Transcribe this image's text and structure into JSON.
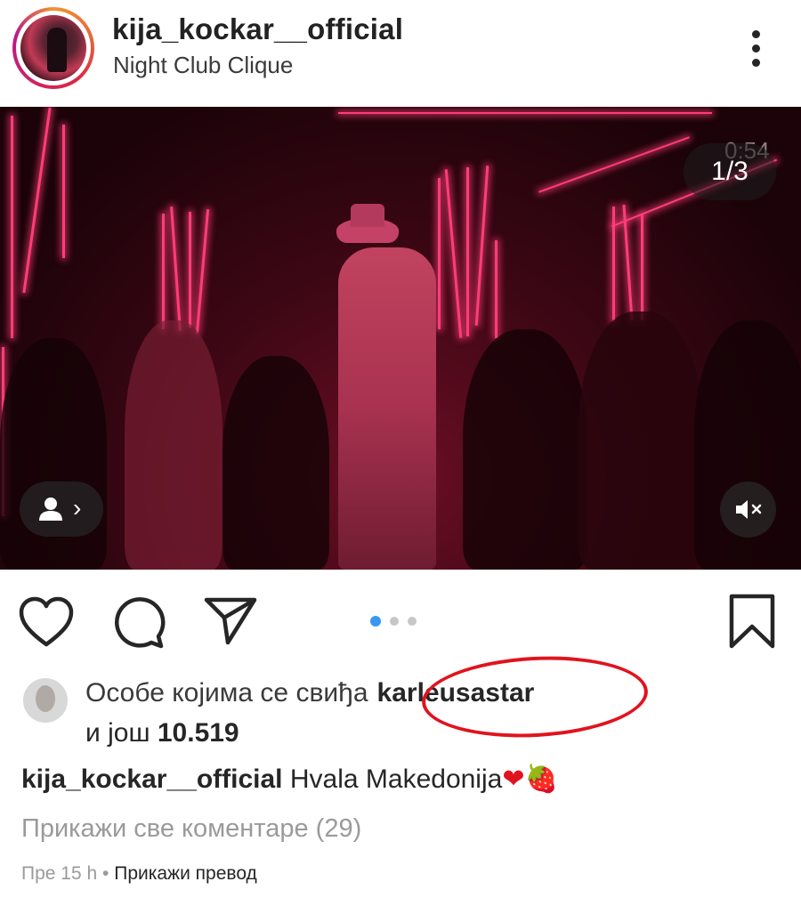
{
  "post": {
    "username": "kija_kockar__official",
    "location": "Night Club Clique",
    "media": {
      "counter": "1/3",
      "overlay_time": "0:54",
      "carousel_total": 3,
      "carousel_active": 1,
      "muted": true
    },
    "likes": {
      "prefix": "Особе којима се свиђа",
      "liker": "karleusastar",
      "and_more_prefix": "и још",
      "count": "10.519"
    },
    "caption": {
      "username": "kija_kockar__official",
      "text": "Hvala Makedonija",
      "heart": "❤",
      "strawberry": "🍓"
    },
    "view_comments": "Прикажи све коментаре (29)",
    "time_ago": "Пре 15 h",
    "separator": "•",
    "translate": "Прикажи превод"
  },
  "icons": {
    "like": "heart-icon",
    "comment": "comment-icon",
    "share": "paper-plane-icon",
    "save": "bookmark-icon",
    "more": "more-vertical-icon",
    "tag": "person-icon",
    "mute": "speaker-muted-icon"
  },
  "colors": {
    "carousel_active_dot": "#3897f0",
    "carousel_inactive_dot": "#c7c7c7",
    "highlight": "#e0141e",
    "secondary_text": "#9a9a9a"
  }
}
